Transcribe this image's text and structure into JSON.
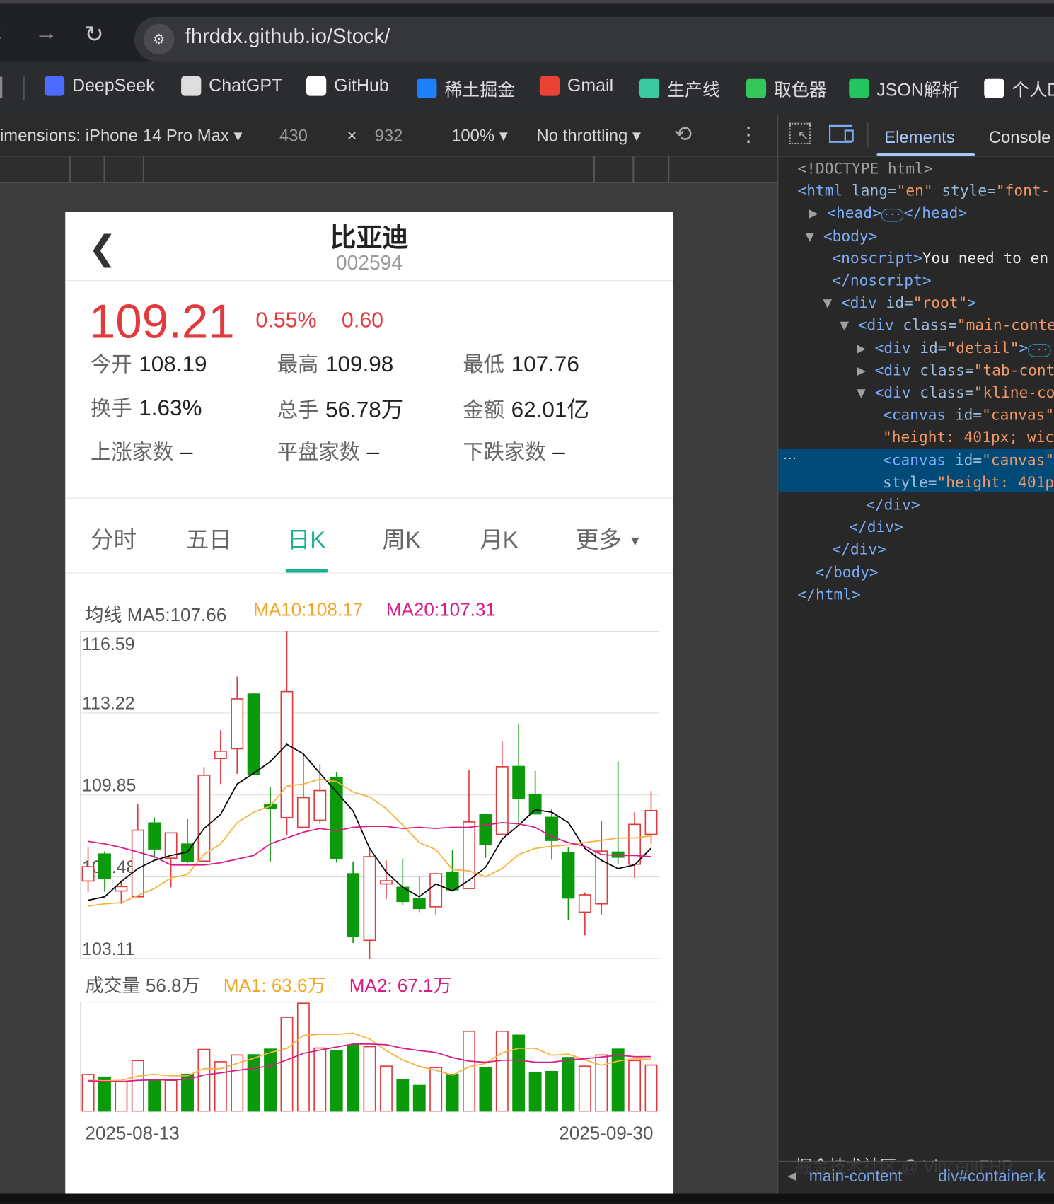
{
  "browser": {
    "url": "fhrddx.github.io/Stock/",
    "bookmarks": [
      {
        "label": "DeepSeek",
        "icon": "deepseek-icon",
        "color": "#4d6bfe"
      },
      {
        "label": "ChatGPT",
        "icon": "chatgpt-icon",
        "color": "#dddddd"
      },
      {
        "label": "GitHub",
        "icon": "github-icon",
        "color": "#ffffff"
      },
      {
        "label": "稀土掘金",
        "icon": "juejin-icon",
        "color": "#1e80ff"
      },
      {
        "label": "Gmail",
        "icon": "gmail-icon",
        "color": "#ea4335"
      },
      {
        "label": "生产线",
        "icon": "chart-icon",
        "color": "#3cc8a0"
      },
      {
        "label": "取色器",
        "icon": "color-picker-icon",
        "color": "#34c759"
      },
      {
        "label": "JSON解析",
        "icon": "json-icon",
        "color": "#22c55e"
      },
      {
        "label": "个人D",
        "icon": "cat-icon",
        "color": "#ffffff"
      }
    ]
  },
  "device_toolbar": {
    "dimensions": "imensions: iPhone 14 Pro Max",
    "width": "430",
    "x": "×",
    "height": "932",
    "zoom": "100%",
    "throttling": "No throttling"
  },
  "stock": {
    "name": "比亚迪",
    "code": "002594",
    "price": "109.21",
    "change_pct": "0.55%",
    "change": "0.60",
    "stats": [
      [
        {
          "label": "今开",
          "value": "108.19"
        },
        {
          "label": "最高",
          "value": "109.98"
        },
        {
          "label": "最低",
          "value": "107.76"
        }
      ],
      [
        {
          "label": "换手",
          "value": "1.63%"
        },
        {
          "label": "总手",
          "value": "56.78万"
        },
        {
          "label": "金额",
          "value": "62.01亿"
        }
      ],
      [
        {
          "label": "上涨家数",
          "value": "–"
        },
        {
          "label": "平盘家数",
          "value": "–"
        },
        {
          "label": "下跌家数",
          "value": "–"
        }
      ]
    ],
    "up_color": "#e03a3e",
    "down_color": "#0a9a0a",
    "accent": "#19b394"
  },
  "tabs": [
    {
      "label": "分时"
    },
    {
      "label": "五日"
    },
    {
      "label": "日K",
      "active": true
    },
    {
      "label": "周K"
    },
    {
      "label": "月K"
    },
    {
      "label": "更多"
    }
  ],
  "legend": {
    "ma_prefix": "均线 MA5:107.66",
    "ma10": "MA10:108.17",
    "ma20": "MA20:107.31",
    "vol": "成交量 56.8万",
    "vma1": "MA1: 63.6万",
    "vma2": "MA2: 67.1万"
  },
  "chart_data": [
    {
      "type": "candlestick",
      "ylim": [
        103.11,
        116.59
      ],
      "yticks": [
        "116.59",
        "113.22",
        "109.85",
        "106.48",
        "103.11"
      ],
      "grid": true,
      "x_labels": [
        "2025-08-13",
        "2025-09-30"
      ],
      "ohlc": [
        [
          106.31,
          107.69,
          105.86,
          106.9
        ],
        [
          107.42,
          107.53,
          105.86,
          106.41
        ],
        [
          105.9,
          106.34,
          105.37,
          106.08
        ],
        [
          105.66,
          109.48,
          105.66,
          108.4
        ],
        [
          108.7,
          108.92,
          107.26,
          107.63
        ],
        [
          107.25,
          108.29,
          106.05,
          108.29
        ],
        [
          107.83,
          108.85,
          107.05,
          107.11
        ],
        [
          107.13,
          111.0,
          107.13,
          110.66
        ],
        [
          111.35,
          112.51,
          110.3,
          111.65
        ],
        [
          111.75,
          114.71,
          110.72,
          113.8
        ],
        [
          114.0,
          114.06,
          110.69,
          110.69
        ],
        [
          109.46,
          110.19,
          107.11,
          109.31
        ],
        [
          108.92,
          116.59,
          108.18,
          114.1
        ],
        [
          108.52,
          111.51,
          108.52,
          109.74
        ],
        [
          108.81,
          111.11,
          108.66,
          110.03
        ],
        [
          110.57,
          110.77,
          107.07,
          107.23
        ],
        [
          106.61,
          107.11,
          103.76,
          104.02
        ],
        [
          103.87,
          107.6,
          103.11,
          107.31
        ],
        [
          106.19,
          107.16,
          105.57,
          106.32
        ],
        [
          106.05,
          107.24,
          105.32,
          105.47
        ],
        [
          105.59,
          106.48,
          105.03,
          105.18
        ],
        [
          105.25,
          106.65,
          104.94,
          106.61
        ],
        [
          106.68,
          107.58,
          105.9,
          105.95
        ],
        [
          106.0,
          110.88,
          106.0,
          108.74
        ],
        [
          109.05,
          109.05,
          107.26,
          107.81
        ],
        [
          108.23,
          112.05,
          108.23,
          111.01
        ],
        [
          111.02,
          112.8,
          108.71,
          109.72
        ],
        [
          109.86,
          110.84,
          109.05,
          109.07
        ],
        [
          108.93,
          109.29,
          107.18,
          107.98
        ],
        [
          107.48,
          107.69,
          104.7,
          105.61
        ],
        [
          105.03,
          105.84,
          104.07,
          105.74
        ],
        [
          105.37,
          108.79,
          104.94,
          107.54
        ],
        [
          107.5,
          111.22,
          107.02,
          107.29
        ],
        [
          107.0,
          109.14,
          106.44,
          108.64
        ],
        [
          108.23,
          110.01,
          107.84,
          109.21
        ]
      ],
      "series": [
        {
          "name": "MA5",
          "color": "#000000",
          "values": [
            105.52,
            105.66,
            106.29,
            106.82,
            107.16,
            107.36,
            107.5,
            108.47,
            109.05,
            110.3,
            110.74,
            111.22,
            111.93,
            111.54,
            110.74,
            109.97,
            109.19,
            107.65,
            106.68,
            106.05,
            105.66,
            106.19,
            105.9,
            106.34,
            106.87,
            108.03,
            108.61,
            109.24,
            109.14,
            108.71,
            107.65,
            107.16,
            106.82,
            106.97,
            107.66
          ]
        },
        {
          "name": "MA10",
          "color": "#f7b13c",
          "values": [
            105.28,
            105.37,
            105.42,
            105.71,
            106.0,
            106.44,
            106.58,
            107.4,
            107.84,
            108.71,
            109.14,
            109.39,
            110.21,
            110.3,
            110.5,
            110.4,
            109.97,
            109.77,
            109.29,
            108.61,
            107.89,
            107.6,
            106.78,
            106.73,
            106.49,
            106.82,
            107.4,
            107.65,
            107.74,
            107.79,
            107.89,
            107.98,
            108.08,
            108.08,
            108.17
          ]
        },
        {
          "name": "MA20",
          "color": "#d81b87",
          "values": [
            107.94,
            107.84,
            107.69,
            107.5,
            107.31,
            106.97,
            106.97,
            106.97,
            107.06,
            107.21,
            107.36,
            107.84,
            108.08,
            108.32,
            108.47,
            108.37,
            108.52,
            108.56,
            108.56,
            108.47,
            108.52,
            108.47,
            108.52,
            108.52,
            108.61,
            108.71,
            108.66,
            108.52,
            108.13,
            107.89,
            107.74,
            107.4,
            107.36,
            107.36,
            107.31
          ]
        }
      ]
    },
    {
      "type": "bar",
      "unit": "万",
      "ylim": [
        0,
        132
      ],
      "values": [
        45.2,
        42.0,
        36.6,
        62.2,
        38.1,
        38.1,
        45.4,
        75.8,
        60.8,
        69.0,
        69.3,
        76.1,
        115.0,
        132.1,
        77.5,
        74.4,
        81.2,
        79.2,
        55.4,
        38.6,
        31.8,
        53.7,
        45.4,
        98.0,
        54.0,
        98.0,
        93.2,
        47.1,
        48.8,
        65.9,
        55.4,
        69.0,
        76.1,
        62.2,
        56.8
      ],
      "series": [
        {
          "name": "MA1",
          "color": "#f7b13c",
          "values": [
            38.1,
            37.5,
            38.1,
            43.2,
            45.4,
            43.7,
            43.7,
            52.3,
            52.3,
            58.8,
            65.0,
            72.1,
            77.0,
            92.9,
            94.3,
            94.3,
            95.7,
            88.6,
            74.4,
            63.0,
            55.1,
            50.3,
            44.6,
            54.5,
            58.8,
            71.6,
            77.2,
            77.2,
            68.7,
            70.1,
            63.0,
            56.5,
            61.6,
            64.5,
            63.6
          ]
        },
        {
          "name": "MA2",
          "color": "#d81b87",
          "values": [
            37.5,
            36.6,
            36.6,
            38.1,
            38.6,
            38.6,
            39.2,
            44.6,
            47.1,
            50.3,
            52.8,
            55.7,
            63.0,
            71.0,
            75.0,
            78.7,
            82.4,
            82.4,
            81.5,
            77.2,
            74.4,
            72.1,
            65.9,
            61.6,
            60.2,
            62.5,
            63.0,
            60.2,
            60.2,
            63.0,
            64.5,
            66.5,
            68.7,
            67.0,
            67.1
          ]
        }
      ]
    }
  ],
  "devtools": {
    "tabs": [
      "Elements",
      "Console"
    ],
    "lines": [
      [
        [
          "c-gray",
          "<!DOCTYPE html>"
        ]
      ],
      [
        [
          "c-tag",
          "<html "
        ],
        [
          "c-attr",
          "lang="
        ],
        [
          "c-val",
          "\"en\""
        ],
        [
          "c-attr",
          " style="
        ],
        [
          "c-val",
          "\"font-"
        ]
      ],
      [
        [
          "c-gray",
          "▶ "
        ],
        [
          "c-tag",
          "<head>"
        ],
        [
          "c-ell",
          "···"
        ],
        [
          "c-tag",
          "</head>"
        ]
      ],
      [
        [
          "c-gray",
          "▼ "
        ],
        [
          "c-tag",
          "<body>"
        ]
      ],
      [
        [
          "c-tag",
          "<noscript>"
        ],
        [
          "c-text",
          "You need to en"
        ]
      ],
      [
        [
          "c-tag",
          "</noscript>"
        ]
      ],
      [
        [
          "c-gray",
          "▼ "
        ],
        [
          "c-tag",
          "<div "
        ],
        [
          "c-attr",
          "id="
        ],
        [
          "c-val",
          "\"root\""
        ],
        [
          "c-tag",
          ">"
        ]
      ],
      [
        [
          "c-gray",
          "▼ "
        ],
        [
          "c-tag",
          "<div "
        ],
        [
          "c-attr",
          "class="
        ],
        [
          "c-val",
          "\"main-conte"
        ]
      ],
      [
        [
          "c-gray",
          "▶ "
        ],
        [
          "c-tag",
          "<div "
        ],
        [
          "c-attr",
          "id="
        ],
        [
          "c-val",
          "\"detail\""
        ],
        [
          "c-tag",
          ">"
        ],
        [
          "c-ell",
          "···"
        ]
      ],
      [
        [
          "c-gray",
          "▶ "
        ],
        [
          "c-tag",
          "<div "
        ],
        [
          "c-attr",
          "class="
        ],
        [
          "c-val",
          "\"tab-cont"
        ]
      ],
      [
        [
          "c-gray",
          "▼ "
        ],
        [
          "c-tag",
          "<div "
        ],
        [
          "c-attr",
          "class="
        ],
        [
          "c-val",
          "\"kline-co"
        ]
      ],
      [
        [
          "c-tag",
          "<canvas "
        ],
        [
          "c-attr",
          "id="
        ],
        [
          "c-val",
          "\"canvas\""
        ]
      ],
      [
        [
          "c-val",
          "\"height: 401px; wic"
        ]
      ],
      [
        [
          "c-tag",
          "<canvas "
        ],
        [
          "c-attr",
          "id="
        ],
        [
          "c-val",
          "\"canvas\""
        ]
      ],
      [
        [
          "c-attr",
          "style="
        ],
        [
          "c-val",
          "\"height: 401p"
        ]
      ],
      [
        [
          "c-tag",
          "</div>"
        ]
      ],
      [
        [
          "c-tag",
          "</div>"
        ]
      ],
      [
        [
          "c-tag",
          "</div>"
        ]
      ],
      [
        [
          "c-tag",
          "</body>"
        ]
      ],
      [
        [
          "c-tag",
          "</html>"
        ]
      ]
    ],
    "selected_dots": "···",
    "breadcrumb": [
      "main-content",
      "div#container.k"
    ],
    "watermark": "掘金技术社区 @ VincentFHR"
  }
}
